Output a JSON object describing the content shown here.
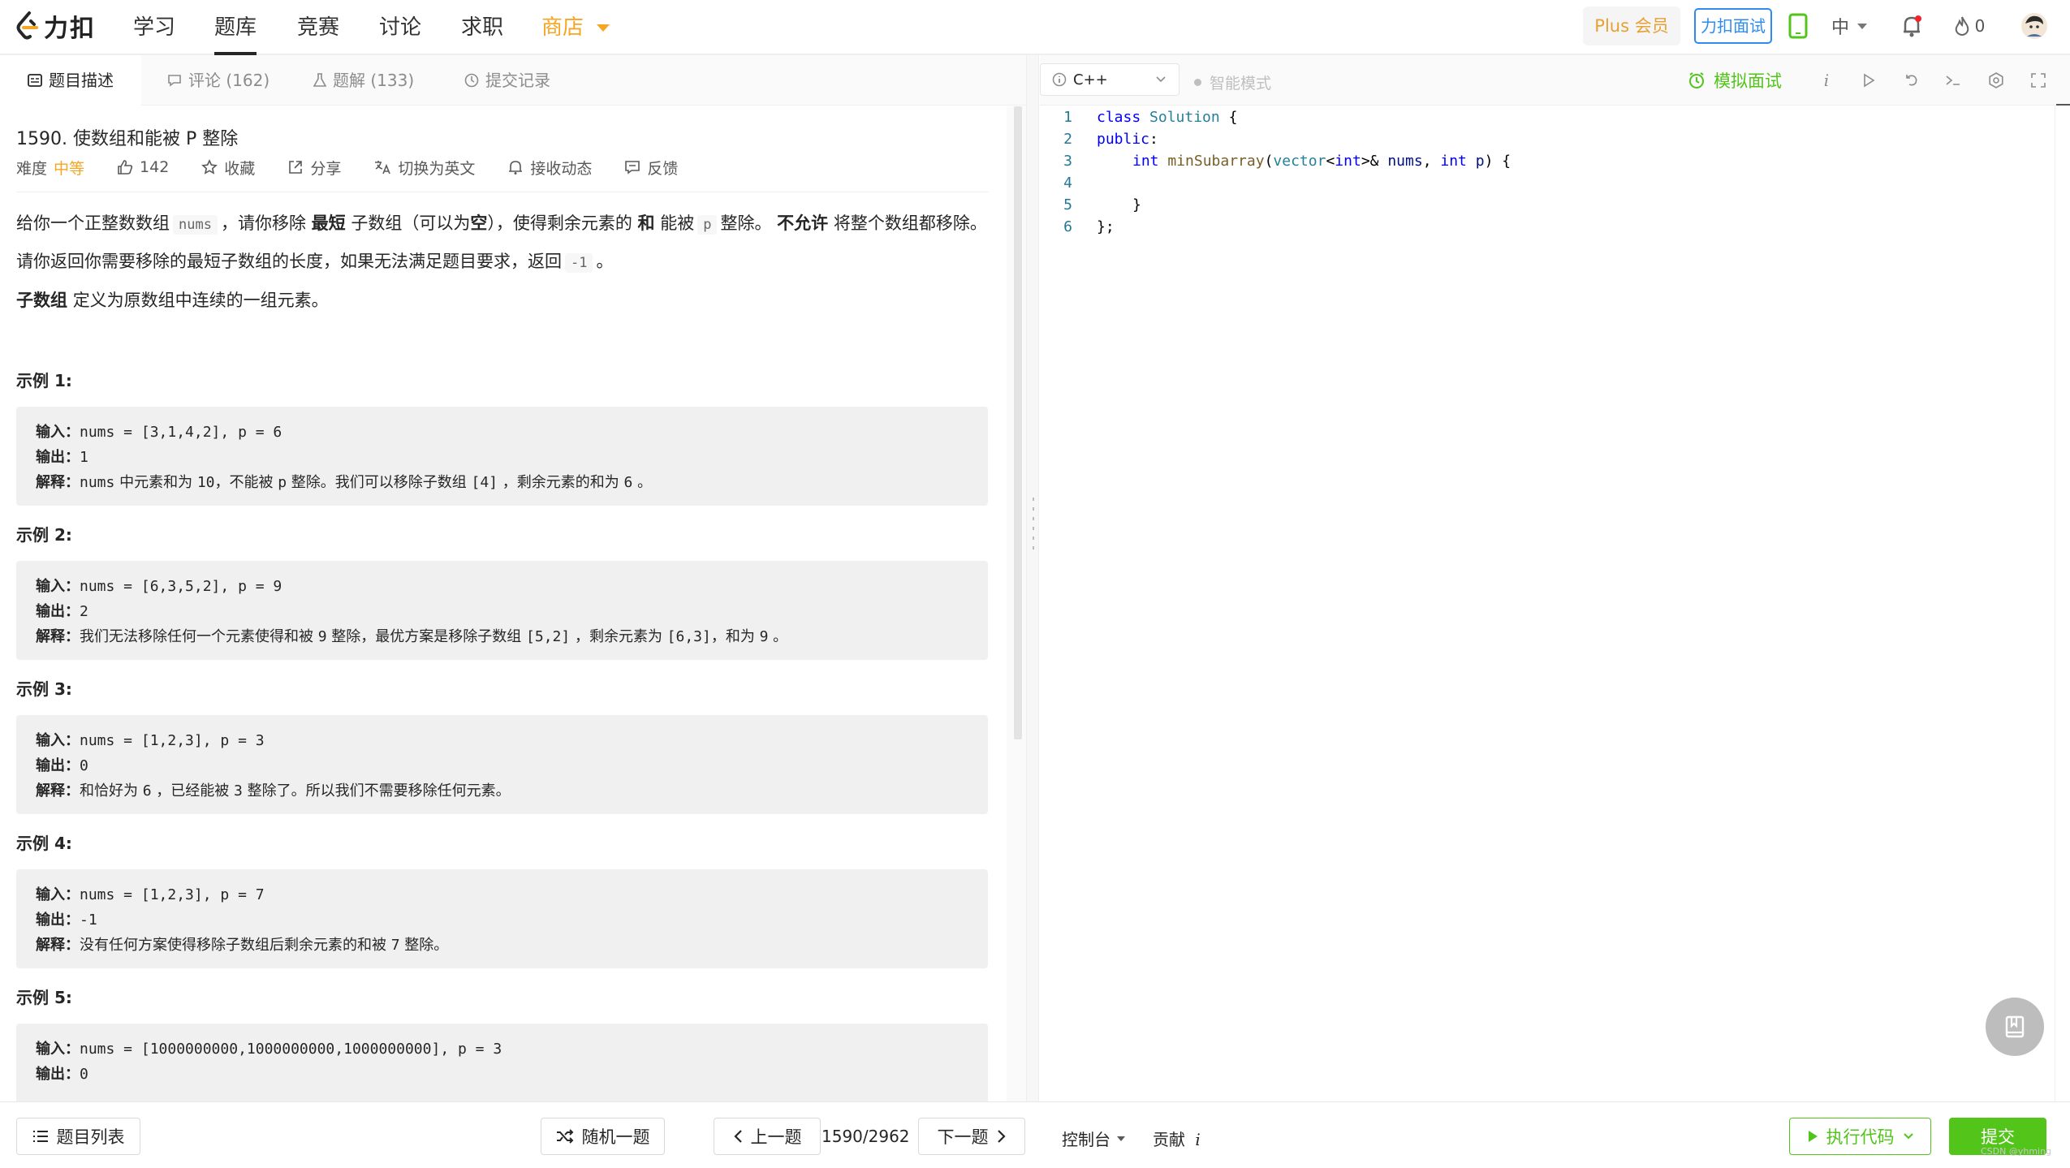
{
  "nav": {
    "logo_text": "力扣",
    "items": [
      {
        "label": "学习",
        "active": false
      },
      {
        "label": "题库",
        "active": true
      },
      {
        "label": "竞赛",
        "active": false
      },
      {
        "label": "讨论",
        "active": false
      },
      {
        "label": "求职",
        "active": false
      },
      {
        "label": "商店",
        "active": false
      }
    ],
    "plus_label": "Plus 会员",
    "interview_label": "力扣面试",
    "lang_label": "中",
    "streak_count": "0"
  },
  "left_tabs": [
    {
      "label": "题目描述",
      "icon": "description-icon"
    },
    {
      "label": "评论 (162)",
      "icon": "comment-icon"
    },
    {
      "label": "题解 (133)",
      "icon": "flask-icon"
    },
    {
      "label": "提交记录",
      "icon": "history-icon"
    }
  ],
  "problem": {
    "title": "1590. 使数组和能被 P 整除",
    "difficulty_label": "难度",
    "difficulty_value": "中等",
    "likes": "142",
    "favorite_label": "收藏",
    "share_label": "分享",
    "switch_lang_label": "切换为英文",
    "subscribe_label": "接收动态",
    "feedback_label": "反馈",
    "desc1": {
      "t1": "给你一个正整数数组",
      "c1": "nums",
      "t2": "，请你移除",
      "b1": "最短",
      "t3": "子数组（可以为",
      "b2": "空",
      "t4": "），使得剩余元素的",
      "b3": "和",
      "t5": "能被",
      "c2": "p",
      "t6": "整除。",
      "b4": "不允许",
      "t7": "将整个数组都移除。"
    },
    "desc2": {
      "t1": "请你返回你需要移除的最短子数组的长度，如果无法满足题目要求，返回",
      "c1": "-1",
      "t2": "。"
    },
    "desc3": {
      "b1": "子数组",
      "t1": "定义为原数组中连续的一组元素。"
    }
  },
  "examples": [
    {
      "title": "示例 1:",
      "input_label": "输入：",
      "input": "nums = [3,1,4,2], p = 6",
      "output_label": "输出：",
      "output": "1",
      "explain_label": "解释：",
      "explain_parts": [
        "nums",
        " 中元素和为 ",
        "10",
        "，不能被 ",
        "p",
        " 整除。我们可以移除子数组 ",
        "[4]",
        " ，剩余元素的和为 ",
        "6",
        " 。"
      ]
    },
    {
      "title": "示例 2:",
      "input_label": "输入：",
      "input": "nums = [6,3,5,2], p = 9",
      "output_label": "输出：",
      "output": "2",
      "explain_label": "解释：",
      "explain_parts": [
        "我们无法移除任何一个元素使得和被 ",
        "9",
        " 整除，最优方案是移除子数组 ",
        "[5,2]",
        " ，剩余元素为 ",
        "[6,3]",
        "，和为 ",
        "9",
        " 。"
      ]
    },
    {
      "title": "示例 3:",
      "input_label": "输入：",
      "input": "nums = [1,2,3], p = 3",
      "output_label": "输出：",
      "output": "0",
      "explain_label": "解释：",
      "explain_parts": [
        "和恰好为 ",
        "6",
        " ，已经能被 ",
        "3",
        " 整除了。所以我们不需要移除任何元素。"
      ]
    },
    {
      "title": "示例  4:",
      "input_label": "输入：",
      "input": "nums = [1,2,3], p = 7",
      "output_label": "输出：",
      "output": "-1",
      "explain_label": "解释：",
      "explain_parts": [
        "没有任何方案使得移除子数组后剩余元素的和被 ",
        "7",
        " 整除。"
      ]
    },
    {
      "title": "示例 5:",
      "input_label": "输入：",
      "input": "nums = [1000000000,1000000000,1000000000], p = 3",
      "output_label": "输出：",
      "output": "0"
    }
  ],
  "editor": {
    "language": "C++",
    "smart_mode_label": "智能模式",
    "mock_interview_label": "模拟面试",
    "line_numbers": [
      "1",
      "2",
      "3",
      "4",
      "5",
      "6"
    ],
    "code": {
      "l1_kw": "class",
      "l1_name": " Solution",
      "l1_rest": " {",
      "l2_kw": "public",
      "l2_rest": ":",
      "l3_kw": "int",
      "l3_fn": "minSubarray",
      "l3_p1": "(",
      "l3_ty": "vector",
      "l3_p2": "<",
      "l3_kw2": "int",
      "l3_p3": ">& ",
      "l3_pm": "nums",
      "l3_p4": ", ",
      "l3_kw3": "int",
      "l3_pm2": " p",
      "l3_p5": ") {",
      "l5": "}",
      "l6": "};"
    }
  },
  "bottom": {
    "problem_list_label": "题目列表",
    "random_label": "随机一题",
    "prev_label": "上一题",
    "page_counter": "1590/2962",
    "next_label": "下一题",
    "console_label": "控制台",
    "contribute_label": "贡献",
    "run_label": "执行代码",
    "submit_label": "提交",
    "watermark": "CSDN @yhming"
  },
  "colors": {
    "accent_green": "#52c41a",
    "shop_orange": "#f5a623",
    "interview_blue": "#2d8cf0"
  }
}
